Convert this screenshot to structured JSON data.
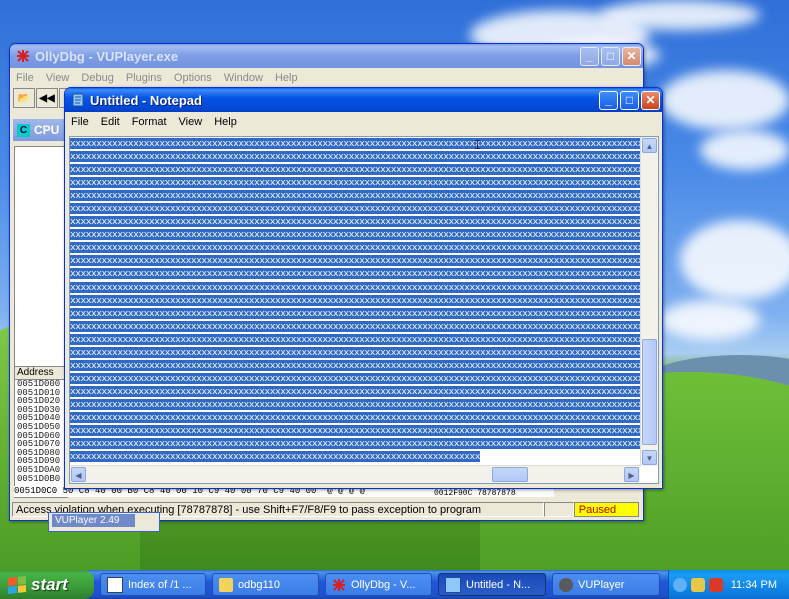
{
  "olly": {
    "title": "OllyDbg - VUPlayer.exe",
    "menu": [
      "File",
      "View",
      "Debug",
      "Plugins",
      "Options",
      "Window",
      "Help"
    ],
    "toolbar": [
      "📂",
      "◀◀",
      "✕"
    ],
    "cpu_label": "CPU",
    "cpu_icon": "C",
    "address_header": "Address",
    "addresses": [
      "0051D000",
      "0051D010",
      "0051D020",
      "0051D030",
      "0051D040",
      "0051D050",
      "0051D060",
      "0051D070",
      "0051D080",
      "0051D090",
      "0051D0A0",
      "0051D0B0"
    ],
    "hex_row": "0051D0C0 50 C8 40 00 B0 C8 40 00 10 C9 40 00 70 C9 40 00 '@'@'@'@",
    "stack_rows": [
      "0012F90C  78787878",
      "0012F90C  78787878"
    ],
    "status_message": "Access violation when executing [78787878] - use Shift+F7/F8/F9 to pass exception to program",
    "status_state": "Paused"
  },
  "ghost": {
    "label": "VUPlayer 2.49"
  },
  "notepad": {
    "title": "Untitled - Notepad",
    "menu": [
      "File",
      "Edit",
      "Format",
      "View",
      "Help"
    ],
    "line_full": "xxxxxxxxxxxxxxxxxxxxxxxxxxxxxxxxxxxxxxxxxxxxxxxxxxxxxxxxxxxxxxxxxxxxxxxxxxxxxxxxxxxxxxxxxxxxxxxxxxxxxxxxxxxxxxxxxxx",
    "line_last": "xxxxxxxxxxxxxxxxxxxxxxxxxxxxxxxxxxxxxxxxxxxxxxxxxxxxxxxxxxxxxxxxxxxxxxxxxxxxxx",
    "full_line_count": 24
  },
  "taskbar": {
    "start": "start",
    "tasks": [
      {
        "label": "Index of /1 ...",
        "icon_color": "#ffffff"
      },
      {
        "label": "odbg110",
        "icon_color": "#f5d25a"
      },
      {
        "label": "OllyDbg - V...",
        "icon_color": "#d81e1e"
      },
      {
        "label": "Untitled - N...",
        "icon_color": "#8fc8f8"
      },
      {
        "label": "VUPlayer",
        "icon_color": "#5a5a5a"
      }
    ],
    "clock": "11:34 PM"
  },
  "colors": {
    "selection": "#316ac5",
    "xp_blue": "#0754e6",
    "paused_bg": "#ffff00",
    "paused_text": "#c00000"
  }
}
